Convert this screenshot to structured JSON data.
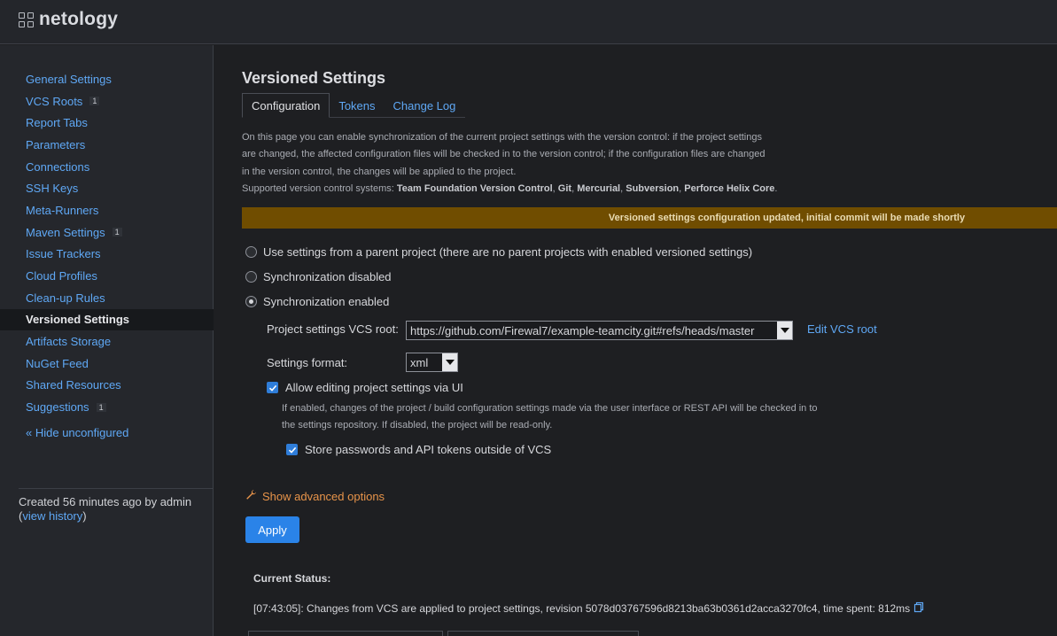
{
  "brand": {
    "name": "netology"
  },
  "sidebar": {
    "items": [
      {
        "label": "General Settings",
        "count": ""
      },
      {
        "label": "VCS Roots",
        "count": "1"
      },
      {
        "label": "Report Tabs",
        "count": ""
      },
      {
        "label": "Parameters",
        "count": ""
      },
      {
        "label": "Connections",
        "count": ""
      },
      {
        "label": "SSH Keys",
        "count": ""
      },
      {
        "label": "Meta-Runners",
        "count": ""
      },
      {
        "label": "Maven Settings",
        "count": "1"
      },
      {
        "label": "Issue Trackers",
        "count": ""
      },
      {
        "label": "Cloud Profiles",
        "count": ""
      },
      {
        "label": "Clean-up Rules",
        "count": ""
      },
      {
        "label": "Versioned Settings",
        "count": "",
        "active": true
      },
      {
        "label": "Artifacts Storage",
        "count": ""
      },
      {
        "label": "NuGet Feed",
        "count": ""
      },
      {
        "label": "Shared Resources",
        "count": ""
      },
      {
        "label": "Suggestions",
        "count": "1"
      }
    ],
    "hide_unconfigured": "« Hide unconfigured",
    "created_text": "Created 56 minutes ago by admin",
    "history_open": "(",
    "history_link": "view history",
    "history_close": ")"
  },
  "main": {
    "title": "Versioned Settings",
    "tabs": [
      "Configuration",
      "Tokens",
      "Change Log"
    ],
    "description": {
      "line1": "On this page you can enable synchronization of the current project settings with the version control: if the project settings",
      "line2": "are changed, the affected configuration files will be checked in to the version control; if the configuration files are changed",
      "line3": "in the version control, the changes will be applied to the project.",
      "supported_prefix": "Supported version control systems: ",
      "systems": [
        "Team Foundation Version Control",
        "Git",
        "Mercurial",
        "Subversion",
        "Perforce Helix Core"
      ],
      "sep": ", ",
      "end": "."
    },
    "banner": "Versioned settings configuration updated, initial commit will be made shortly",
    "radios": {
      "parent": "Use settings from a parent project (there are no parent projects with enabled versioned settings)",
      "disabled": "Synchronization disabled",
      "enabled": "Synchronization enabled",
      "selected": "enabled"
    },
    "vcs_root_label": "Project settings VCS root:",
    "vcs_root_value": "https://github.com/Firewal7/example-teamcity.git#refs/heads/master",
    "edit_vcs_root": "Edit VCS root",
    "format_label": "Settings format:",
    "format_value": "xml",
    "allow_editing": {
      "label": "Allow editing project settings via UI",
      "checked": true
    },
    "hint_line1": "If enabled, changes of the project / build configuration settings made via the user interface or REST API will be checked in to",
    "hint_line2": "the settings repository. If disabled, the project will be read-only.",
    "store_passwords": {
      "label": "Store passwords and API tokens outside of VCS",
      "checked": true
    },
    "advanced": "Show advanced options",
    "apply": "Apply",
    "status_title": "Current Status:",
    "status_line": "[07:43:05]: Changes from VCS are applied to project settings, revision 5078d03767596d8213ba63b0361d2acca3270fc4, time spent: 812ms"
  },
  "colors": {
    "link": "#5fa8f5",
    "banner": "#704d00",
    "accent": "#2a83e8",
    "advanced": "#e8944a"
  }
}
